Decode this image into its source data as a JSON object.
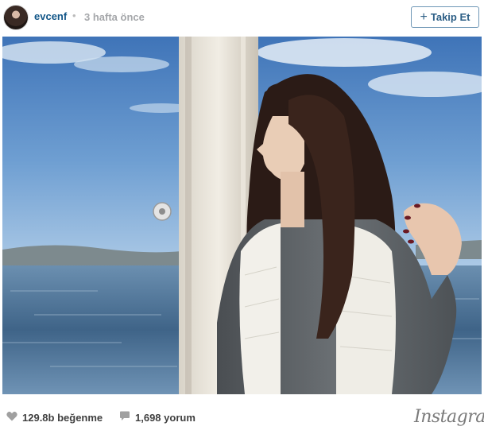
{
  "post": {
    "username": "evcenf",
    "separator": "•",
    "time_ago": "3 hafta önce",
    "follow_label": "Takip Et",
    "follow_plus": "+"
  },
  "footer": {
    "likes": "129.8b beğenme",
    "comments": "1,698 yorum",
    "logo": "Instagram"
  },
  "icons": {
    "like": "heart-icon",
    "comment": "speech-bubble-icon",
    "follow": "plus-icon"
  },
  "colors": {
    "username": "#125688",
    "follow_border": "#6f97b6",
    "muted": "#a5a7aa"
  }
}
